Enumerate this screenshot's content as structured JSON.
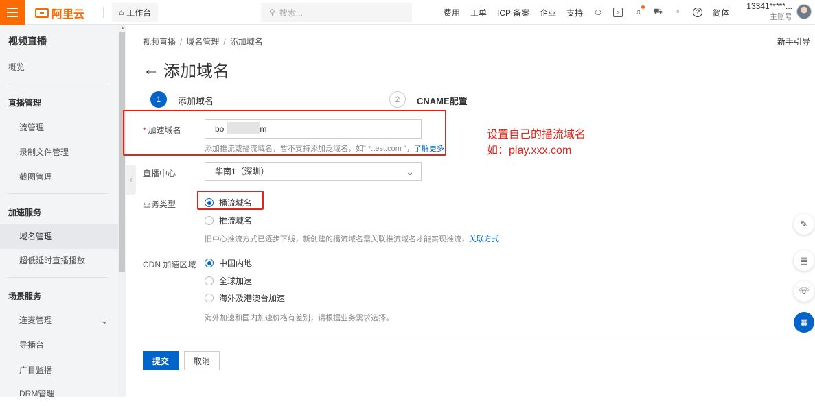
{
  "colors": {
    "brand": "#ff6a00",
    "primary": "#0064c8",
    "annotation_red": "#e1251b"
  },
  "topbar": {
    "logo_text": "阿里云",
    "workbench": "工作台",
    "search_placeholder": "搜索...",
    "nav": [
      "费用",
      "工单",
      "ICP 备案",
      "企业",
      "支持"
    ],
    "lang": "简体",
    "account": "13341*****...",
    "account_sub": "主账号"
  },
  "sidebar": {
    "title": "视频直播",
    "overview": "概览",
    "group_live": "直播管理",
    "stream_mgmt": "流管理",
    "recording_mgmt": "录制文件管理",
    "snapshot_mgmt": "截图管理",
    "group_accel": "加速服务",
    "domain_mgmt": "域名管理",
    "ultra_low_latency": "超低延时直播播放",
    "group_scene": "场景服务",
    "co_streaming": "连麦管理",
    "director": "导播台",
    "monitor": "广目监播",
    "drm": "DRM管理"
  },
  "breadcrumb": [
    "视频直播",
    "域名管理",
    "添加域名"
  ],
  "guide": "新手引导",
  "page_title": "添加域名",
  "steps": [
    {
      "num": "1",
      "label": "添加域名"
    },
    {
      "num": "2",
      "label": "CNAME配置"
    }
  ],
  "form": {
    "domain_label": "加速域名",
    "required_mark": "*",
    "domain_value_start": "bo",
    "domain_value_end": "m",
    "domain_help": "添加推流或播流域名，暂不支持添加泛域名，如\" *.test.com \"，",
    "domain_help_link": "了解更多",
    "center_label": "直播中心",
    "center_value": "华南1（深圳）",
    "biz_label": "业务类型",
    "biz_options": [
      "播流域名",
      "推流域名"
    ],
    "biz_help": "旧中心推流方式已逐步下线，新创建的播流域名需关联推流域名才能实现推流，",
    "biz_help_link": "关联方式",
    "cdn_label": "CDN 加速区域",
    "cdn_options": [
      "中国内地",
      "全球加速",
      "海外及港澳台加速"
    ],
    "cdn_help": "海外加速和国内加速价格有差别，请根据业务需求选择。"
  },
  "annotation": {
    "line1": "设置自己的播流域名",
    "line2": "如：play.xxx.com"
  },
  "buttons": {
    "submit": "提交",
    "cancel": "取消"
  }
}
